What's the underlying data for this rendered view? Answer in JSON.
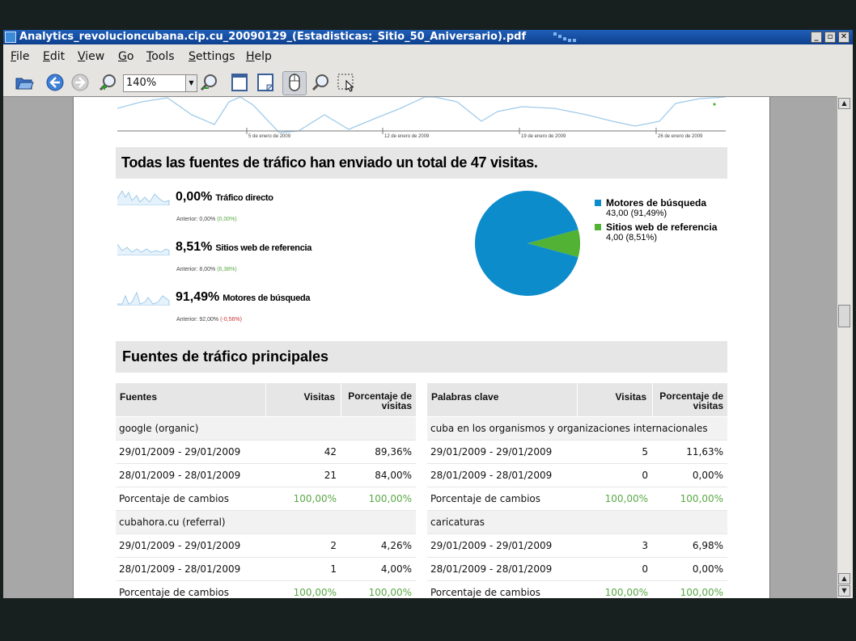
{
  "window": {
    "title": "Analytics_revolucioncubana.cip.cu_20090129_(Estadisticas:_Sitio_50_Aniversario).pdf",
    "minimize_glyph": "_",
    "maximize_glyph": "▫",
    "close_glyph": "✕"
  },
  "menu": [
    {
      "label": "File",
      "mnemonic": "F",
      "rest": "ile"
    },
    {
      "label": "Edit",
      "mnemonic": "E",
      "rest": "dit"
    },
    {
      "label": "View",
      "mnemonic": "V",
      "rest": "iew"
    },
    {
      "label": "Go",
      "mnemonic": "G",
      "rest": "o"
    },
    {
      "label": "Tools",
      "mnemonic": "T",
      "rest": "ools"
    },
    {
      "label": "Settings",
      "mnemonic": "S",
      "rest": "ettings"
    },
    {
      "label": "Help",
      "mnemonic": "H",
      "rest": "elp"
    }
  ],
  "toolbar": {
    "zoom_value": "140%",
    "icons": [
      "open-folder-icon",
      "back-icon",
      "forward-icon",
      "zoom-in-icon",
      "zoom-out-icon",
      "fit-page-icon",
      "fit-width-icon",
      "browse-tool-icon",
      "zoom-tool-icon",
      "select-tool-icon"
    ]
  },
  "report": {
    "top_chart": {
      "axis_dates": [
        "5 de enero de 2009",
        "12 de enero de 2009",
        "19 de enero de 2009",
        "26 de enero de 2009"
      ]
    },
    "traffic_summary_title": "Todas las fuentes de tráfico han enviado un total de 47 visitas.",
    "sources": [
      {
        "pct": "0,00%",
        "label": "Tráfico directo",
        "prev_label": "Anterior: 0,00%",
        "change": "(0,00%)",
        "change_color": "green"
      },
      {
        "pct": "8,51%",
        "label": "Sitios web de referencia",
        "prev_label": "Anterior: 8,00%",
        "change": "(6,38%)",
        "change_color": "green"
      },
      {
        "pct": "91,49%",
        "label": "Motores de búsqueda",
        "prev_label": "Anterior: 92,00%",
        "change": "(-0,56%)",
        "change_color": "red"
      }
    ],
    "pie": {
      "slices": [
        {
          "name": "Motores de búsqueda",
          "value": 43.0,
          "value_text": "43,00 (91,49%)",
          "color": "#0d8ccc"
        },
        {
          "name": "Sitios web de referencia",
          "value": 4.0,
          "value_text": "4,00 (8,51%)",
          "color": "#52b234"
        }
      ]
    },
    "top_sources_title": "Fuentes de tráfico principales",
    "left_table": {
      "headers": [
        "Fuentes",
        "Visitas",
        "Porcentaje de visitas"
      ],
      "rows": [
        {
          "type": "group",
          "cells": [
            "google (organic)",
            "",
            ""
          ]
        },
        {
          "type": "data",
          "cells": [
            "29/01/2009 - 29/01/2009",
            "42",
            "89,36%"
          ]
        },
        {
          "type": "data",
          "cells": [
            "28/01/2009 - 28/01/2009",
            "21",
            "84,00%"
          ]
        },
        {
          "type": "change",
          "cells": [
            "Porcentaje de cambios",
            "100,00%",
            "100,00%"
          ]
        },
        {
          "type": "group",
          "cells": [
            "cubahora.cu (referral)",
            "",
            ""
          ]
        },
        {
          "type": "data",
          "cells": [
            "29/01/2009 - 29/01/2009",
            "2",
            "4,26%"
          ]
        },
        {
          "type": "data",
          "cells": [
            "28/01/2009 - 28/01/2009",
            "1",
            "4,00%"
          ]
        },
        {
          "type": "change",
          "cells": [
            "Porcentaje de cambios",
            "100,00%",
            "100,00%"
          ]
        }
      ]
    },
    "right_table": {
      "headers": [
        "Palabras clave",
        "Visitas",
        "Porcentaje de visitas"
      ],
      "rows": [
        {
          "type": "group",
          "cells": [
            "cuba en los organismos y organizaciones internacionales",
            "",
            ""
          ]
        },
        {
          "type": "data",
          "cells": [
            "29/01/2009 - 29/01/2009",
            "5",
            "11,63%"
          ]
        },
        {
          "type": "data",
          "cells": [
            "28/01/2009 - 28/01/2009",
            "0",
            "0,00%"
          ]
        },
        {
          "type": "change",
          "cells": [
            "Porcentaje de cambios",
            "100,00%",
            "100,00%"
          ]
        },
        {
          "type": "group",
          "cells": [
            "caricaturas",
            "",
            ""
          ]
        },
        {
          "type": "data",
          "cells": [
            "29/01/2009 - 29/01/2009",
            "3",
            "6,98%"
          ]
        },
        {
          "type": "data",
          "cells": [
            "28/01/2009 - 28/01/2009",
            "0",
            "0,00%"
          ]
        },
        {
          "type": "change",
          "cells": [
            "Porcentaje de cambios",
            "100,00%",
            "100,00%"
          ]
        }
      ]
    }
  },
  "colors": {
    "titlebar": "#1f5fb8",
    "pie_blue": "#0d8ccc",
    "pie_green": "#52b234",
    "line": "#9fcbea"
  }
}
